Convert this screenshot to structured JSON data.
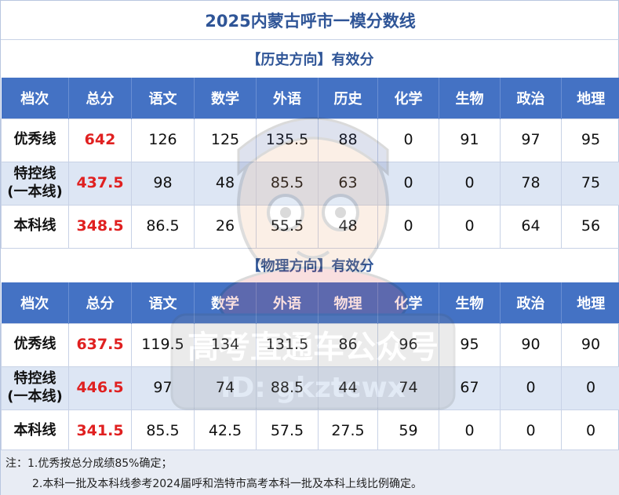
{
  "title": "2025内蒙古呼市一模分数线",
  "history": {
    "heading": "【历史方向】有效分",
    "columns": [
      "档次",
      "总分",
      "语文",
      "数学",
      "外语",
      "历史",
      "化学",
      "生物",
      "政治",
      "地理"
    ],
    "rows": [
      {
        "label": "优秀线",
        "total": "642",
        "scores": [
          "126",
          "125",
          "135.5",
          "88",
          "0",
          "91",
          "97",
          "95"
        ]
      },
      {
        "label_l1": "特控线",
        "label_l2": "(一本线)",
        "total": "437.5",
        "scores": [
          "98",
          "48",
          "85.5",
          "63",
          "0",
          "0",
          "78",
          "75"
        ]
      },
      {
        "label": "本科线",
        "total": "348.5",
        "scores": [
          "86.5",
          "26",
          "55.5",
          "48",
          "0",
          "0",
          "64",
          "56"
        ]
      }
    ]
  },
  "physics": {
    "heading": "【物理方向】有效分",
    "columns": [
      "档次",
      "总分",
      "语文",
      "数学",
      "外语",
      "物理",
      "化学",
      "生物",
      "政治",
      "地理"
    ],
    "rows": [
      {
        "label": "优秀线",
        "total": "637.5",
        "scores": [
          "119.5",
          "134",
          "131.5",
          "86",
          "96",
          "95",
          "90",
          "90"
        ]
      },
      {
        "label_l1": "特控线",
        "label_l2": "(一本线)",
        "total": "446.5",
        "scores": [
          "97",
          "74",
          "88.5",
          "44",
          "74",
          "67",
          "0",
          "0"
        ]
      },
      {
        "label": "本科线",
        "total": "341.5",
        "scores": [
          "85.5",
          "42.5",
          "57.5",
          "27.5",
          "59",
          "0",
          "0",
          "0"
        ]
      }
    ]
  },
  "notes": {
    "line1": "注：1.优秀按总分成绩85%确定；",
    "line2": "2.本科一批及本科线参考2024届呼和浩特市高考本科一批及本科上线比例确定。"
  },
  "watermark": {
    "line1": "高考直通车公众号",
    "line2": "ID: gkztcwx"
  },
  "colors": {
    "header_bg": "#4472c4",
    "title_text": "#2f5597",
    "total_text": "#e02020",
    "alt_row": "#dde6f4"
  }
}
